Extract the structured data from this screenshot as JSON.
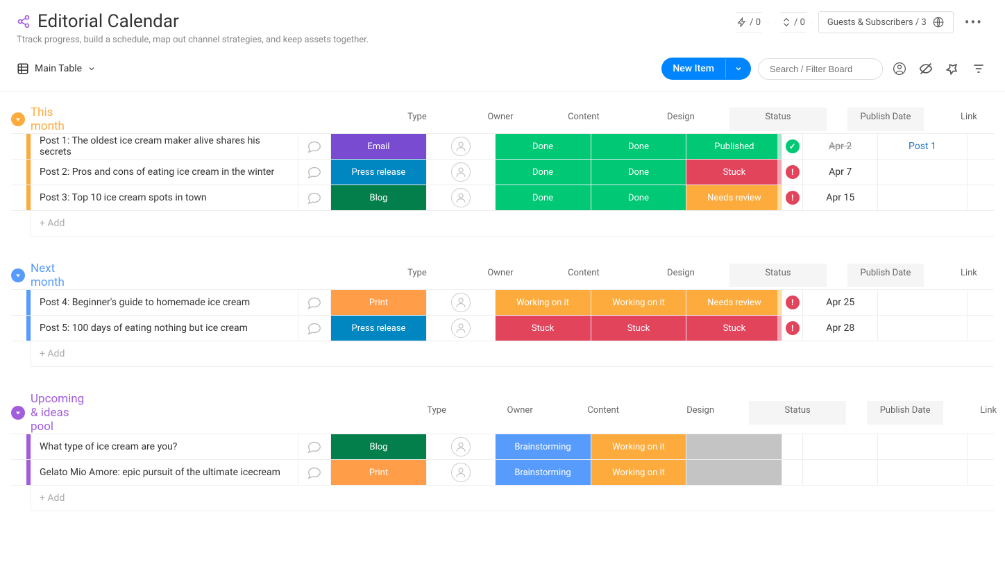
{
  "header": {
    "title": "Editorial Calendar",
    "subtitle": "Ttrack progress, build a schedule, map out channel strategies, and keep assets together.",
    "badge1": "/ 0",
    "badge2": "/ 0",
    "guests": "Guests & Subscribers / 3"
  },
  "toolbar": {
    "view": "Main Table",
    "new_item": "New Item",
    "search_placeholder": "Search / Filter Board"
  },
  "columns": {
    "type": "Type",
    "owner": "Owner",
    "content": "Content",
    "design": "Design",
    "status": "Status",
    "publish_date": "Publish Date",
    "link": "Link"
  },
  "add_row": "+ Add",
  "groups": [
    {
      "title": "This month",
      "color": "#fdab3d",
      "bar": "#fdab3d",
      "bar_light": "#ffe6b3",
      "rows": [
        {
          "name": "Post 1: The oldest ice cream maker alive shares his secrets",
          "type": {
            "label": "Email",
            "color": "#784bd1"
          },
          "content": {
            "label": "Done",
            "color": "#00c875"
          },
          "design": {
            "label": "Done",
            "color": "#00c875"
          },
          "status": {
            "label": "Published",
            "color": "#00c875",
            "edge": "#a7e8cc"
          },
          "warn": {
            "color": "#00c875",
            "glyph": "✓"
          },
          "date": "Apr 2",
          "date_struck": true,
          "link": "Post 1"
        },
        {
          "name": "Post 2: Pros and cons of eating ice cream in the winter",
          "type": {
            "label": "Press release",
            "color": "#0086c0"
          },
          "content": {
            "label": "Done",
            "color": "#00c875"
          },
          "design": {
            "label": "Done",
            "color": "#00c875"
          },
          "status": {
            "label": "Stuck",
            "color": "#e2445c",
            "edge": "#f3a6b1"
          },
          "warn": {
            "color": "#e2445c",
            "glyph": "!"
          },
          "date": "Apr 7"
        },
        {
          "name": "Post 3: Top 10 ice cream spots in town",
          "type": {
            "label": "Blog",
            "color": "#037f4c"
          },
          "content": {
            "label": "Done",
            "color": "#00c875"
          },
          "design": {
            "label": "Done",
            "color": "#00c875"
          },
          "status": {
            "label": "Needs review",
            "color": "#fdab3d",
            "edge": "#fedd9e"
          },
          "warn": {
            "color": "#e2445c",
            "glyph": "!"
          },
          "date": "Apr 15"
        }
      ]
    },
    {
      "title": "Next month",
      "color": "#579bfc",
      "bar": "#579bfc",
      "bar_light": "#c4dbff",
      "rows": [
        {
          "name": "Post 4: Beginner's guide to homemade ice cream",
          "type": {
            "label": "Print",
            "color": "#ff9d48"
          },
          "content": {
            "label": "Working on it",
            "color": "#fdab3d"
          },
          "design": {
            "label": "Working on it",
            "color": "#fdab3d"
          },
          "status": {
            "label": "Needs review",
            "color": "#fdab3d",
            "edge": "#fedd9e"
          },
          "warn": {
            "color": "#e2445c",
            "glyph": "!"
          },
          "date": "Apr 25"
        },
        {
          "name": "Post 5: 100 days of eating nothing but ice cream",
          "type": {
            "label": "Press release",
            "color": "#0086c0"
          },
          "content": {
            "label": "Stuck",
            "color": "#e2445c"
          },
          "design": {
            "label": "Stuck",
            "color": "#e2445c"
          },
          "status": {
            "label": "Stuck",
            "color": "#e2445c",
            "edge": "#f3a6b1"
          },
          "warn": {
            "color": "#e2445c",
            "glyph": "!"
          },
          "date": "Apr 28"
        }
      ]
    },
    {
      "title": "Upcoming & ideas pool",
      "color": "#a25ddc",
      "bar": "#a25ddc",
      "bar_light": "#e0c6f7",
      "rows": [
        {
          "name": "What type of ice cream are you?",
          "type": {
            "label": "Blog",
            "color": "#037f4c"
          },
          "content": {
            "label": "Brainstorming",
            "color": "#579bfc"
          },
          "design": {
            "label": "Working on it",
            "color": "#fdab3d"
          },
          "status": {
            "gray": true
          }
        },
        {
          "name": "Gelato Mio Amore: epic pursuit of the ultimate icecream",
          "type": {
            "label": "Print",
            "color": "#ff9d48"
          },
          "content": {
            "label": "Brainstorming",
            "color": "#579bfc"
          },
          "design": {
            "label": "Working on it",
            "color": "#fdab3d"
          },
          "status": {
            "gray": true
          }
        }
      ]
    }
  ]
}
